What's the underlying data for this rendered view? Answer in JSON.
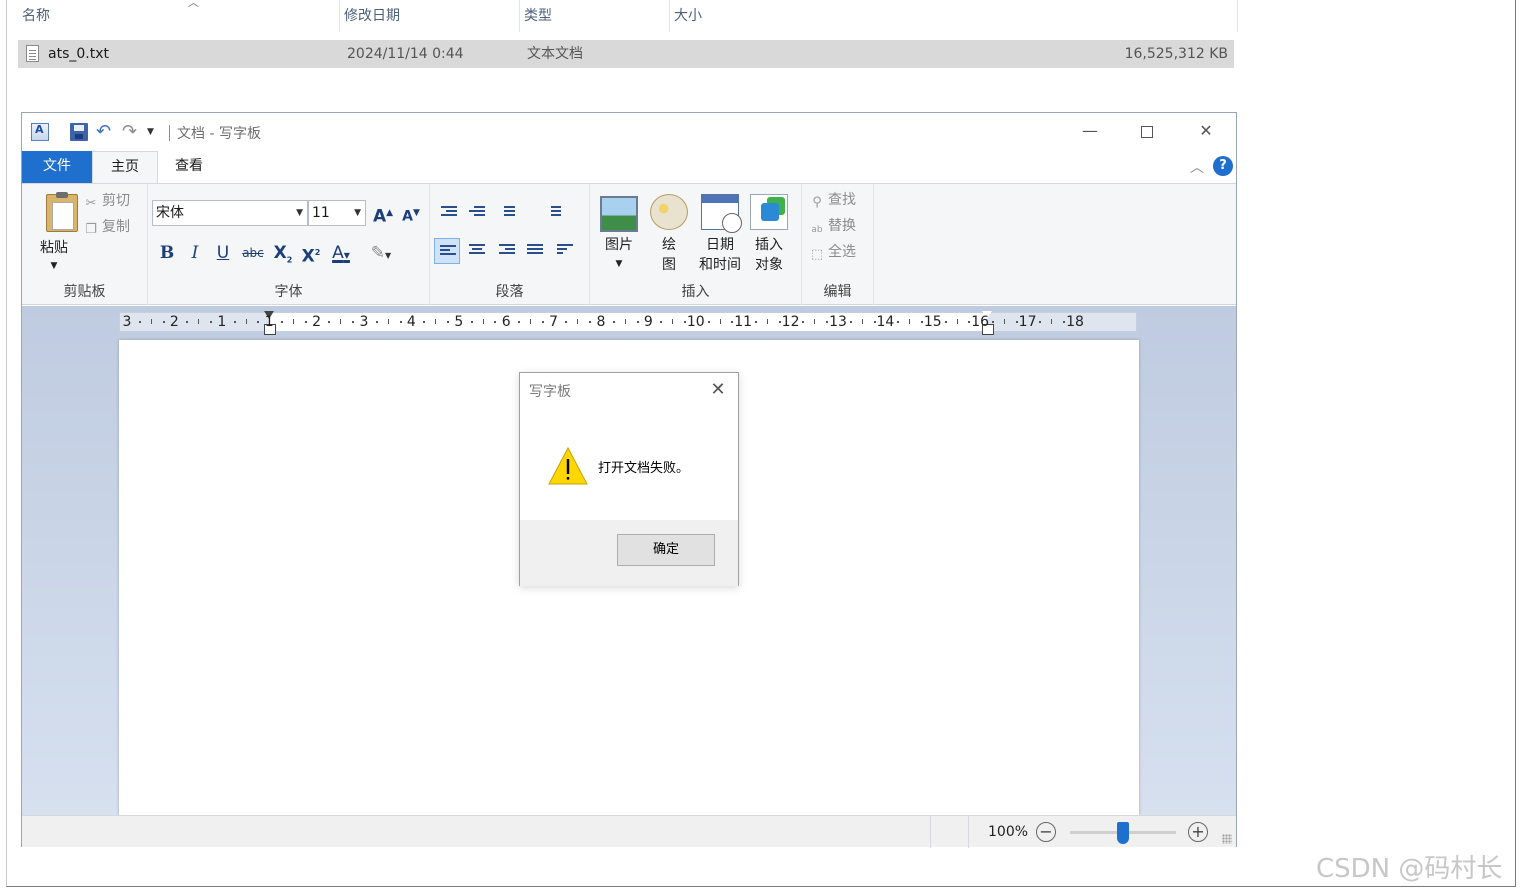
{
  "explorer": {
    "columns": [
      "名称",
      "修改日期",
      "类型",
      "大小"
    ],
    "file": {
      "name": "ats_0.txt",
      "modified": "2024/11/14 0:44",
      "type": "文本文档",
      "size": "16,525,312 KB"
    }
  },
  "wordpad": {
    "title": "文档 - 写字板",
    "tabs": {
      "file": "文件",
      "home": "主页",
      "view": "查看"
    },
    "help": "?",
    "clipboard": {
      "paste": "粘贴",
      "cut": "剪切",
      "copy": "复制",
      "label": "剪贴板"
    },
    "font": {
      "family": "宋体",
      "size": "11",
      "label": "字体"
    },
    "paragraph": {
      "label": "段落"
    },
    "insert": {
      "picture": "图片",
      "paint_1": "绘",
      "paint_2": "图",
      "datetime_1": "日期",
      "datetime_2": "和时间",
      "object_1": "插入",
      "object_2": "对象",
      "label": "插入"
    },
    "editing": {
      "find": "查找",
      "replace": "替换",
      "select_all": "全选",
      "label": "编辑"
    },
    "ruler_labels": [
      "3",
      "2",
      "1",
      "1",
      "2",
      "3",
      "4",
      "5",
      "6",
      "7",
      "8",
      "9",
      "10",
      "11",
      "12",
      "13",
      "14",
      "15",
      "16",
      "17",
      "18"
    ],
    "status": {
      "zoom": "100%"
    }
  },
  "dialog": {
    "title": "写字板",
    "message": "打开文档失败。",
    "ok": "确定"
  },
  "watermark": "CSDN @码村长",
  "colors": {
    "accent": "#1e6fce",
    "file_row": "#d9d9d9",
    "warning": "#ffd700"
  }
}
